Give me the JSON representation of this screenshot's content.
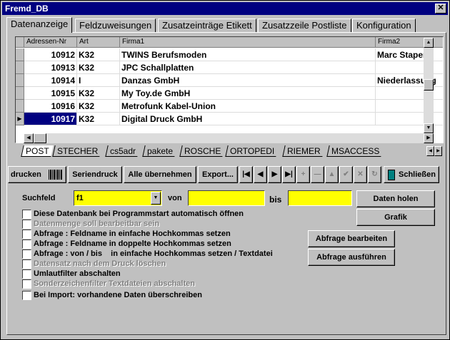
{
  "window": {
    "title": "Fremd_DB",
    "close_glyph": "✕"
  },
  "tabs": [
    "Datenanzeige",
    "Feldzuweisungen",
    "Zusatzeinträge Etikett",
    "Zusatzzeile Postliste",
    "Konfiguration"
  ],
  "grid": {
    "columns": [
      "Adressen-Nr",
      "Art",
      "Firma1",
      "Firma2"
    ],
    "rows": [
      {
        "nr": "10912",
        "art": "K32",
        "firma1": "TWINS Berufsmoden",
        "firma2": "Marc Staperfe"
      },
      {
        "nr": "10913",
        "art": "K32",
        "firma1": "JPC Schallplatten",
        "firma2": ""
      },
      {
        "nr": "10914",
        "art": "I",
        "firma1": "Danzas GmbH",
        "firma2": "Niederlassung"
      },
      {
        "nr": "10915",
        "art": "K32",
        "firma1": "My Toy.de GmbH",
        "firma2": ""
      },
      {
        "nr": "10916",
        "art": "K32",
        "firma1": "Metrofunk Kabel-Union",
        "firma2": ""
      },
      {
        "nr": "10917",
        "art": "K32",
        "firma1": "Digital Druck GmbH",
        "firma2": ""
      }
    ],
    "selected_row_index": 5
  },
  "sheet_tabs": [
    "POST",
    "STECHER",
    "cs5adr",
    "pakete",
    "ROSCHE",
    "ORTOPEDI",
    "RIEMER",
    "MSACCESS"
  ],
  "toolbar": {
    "drucken": "drucken",
    "seriendruck": "Seriendruck",
    "alle": "Alle übernehmen",
    "export": "Export...",
    "nav_first": "|◀",
    "nav_prev": "◀",
    "nav_next": "▶",
    "nav_last": "▶|",
    "nav_add": "+",
    "nav_delete": "—",
    "nav_edit": "▲",
    "nav_post": "✔",
    "nav_cancel": "✕",
    "nav_refresh": "↻",
    "schliessen": "Schließen"
  },
  "search": {
    "suchfeld_label": "Suchfeld",
    "suchfeld_value": "f1",
    "von_label": "von",
    "von_value": "",
    "bis_label": "bis",
    "bis_value": ""
  },
  "actions": {
    "daten_holen": "Daten holen",
    "grafik": "Grafik",
    "abfrage_bearbeiten": "Abfrage bearbeiten",
    "abfrage_ausfuehren": "Abfrage ausführen"
  },
  "options": [
    {
      "label": "Diese Datenbank bei Programmstart automatisch öffnen",
      "enabled": true
    },
    {
      "label": "Datenmenge soll bearbeitbar sein",
      "enabled": false
    },
    {
      "label": "Abfrage : Feldname in einfache Hochkommas setzen",
      "enabled": true
    },
    {
      "label": "Abfrage : Feldname in doppelte Hochkommas setzen",
      "enabled": true
    },
    {
      "label": "Abfrage : von / bis    in einfache Hochkommas setzen / Textdatei",
      "enabled": true
    },
    {
      "label": "Datensatz nach dem Druck löschen",
      "enabled": false
    },
    {
      "label": "Umlautfilter abschalten",
      "enabled": true
    },
    {
      "label": "Sonderzeichenfilter Textdateien abschalten",
      "enabled": false
    },
    {
      "label": "Bei Import: vorhandene Daten überschreiben",
      "enabled": true
    }
  ]
}
